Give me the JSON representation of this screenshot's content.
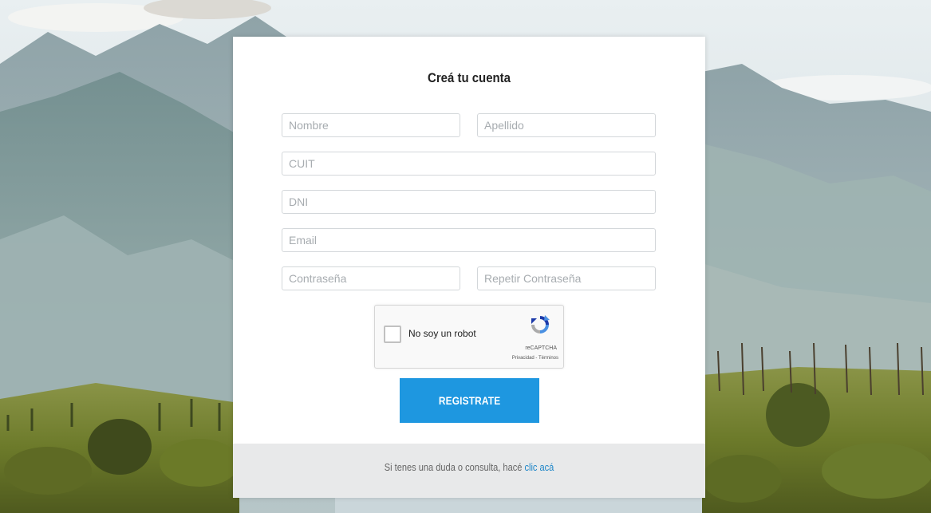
{
  "form": {
    "title": "Creá tu cuenta",
    "fields": {
      "nombre": {
        "placeholder": "Nombre",
        "value": ""
      },
      "apellido": {
        "placeholder": "Apellido",
        "value": ""
      },
      "cuit": {
        "placeholder": "CUIT",
        "value": ""
      },
      "dni": {
        "placeholder": "DNI",
        "value": ""
      },
      "email": {
        "placeholder": "Email",
        "value": ""
      },
      "password": {
        "placeholder": "Contraseña",
        "value": ""
      },
      "password_repeat": {
        "placeholder": "Repetir Contraseña",
        "value": ""
      }
    },
    "captcha": {
      "label": "No soy un robot",
      "brand": "reCAPTCHA",
      "links": "Privacidad - Términos",
      "checked": false
    },
    "submit_label": "REGISTRATE"
  },
  "footer": {
    "text": "Si tenes una duda o consulta, hacé",
    "link_label": "clic acá"
  },
  "colors": {
    "primary_button": "#1e97e0",
    "link": "#1e86c8",
    "footer_bg": "#e8e9ea"
  }
}
